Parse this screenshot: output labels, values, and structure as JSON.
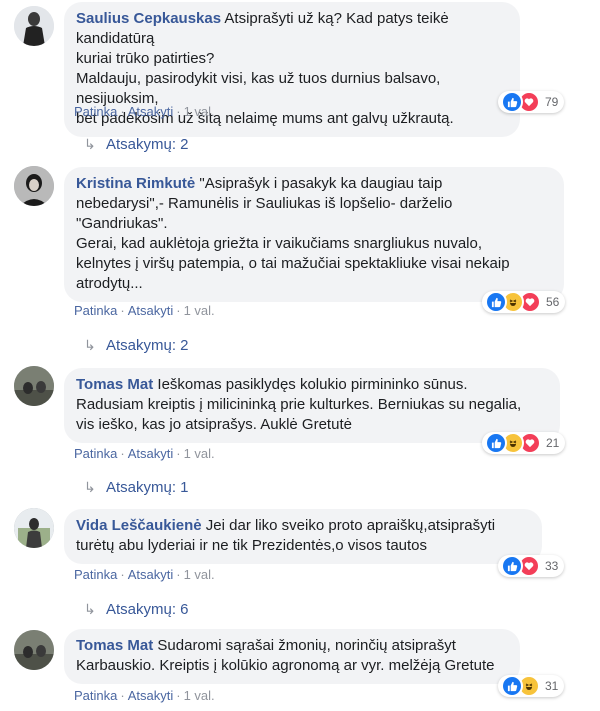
{
  "actions": {
    "like": "Patinka",
    "reply": "Atsakyti",
    "separator": "·"
  },
  "comments": [
    {
      "author": "Saulius Cepkauskas",
      "lines": [
        "Atsiprašyti už ką? Kad patys teikė kandidatūrą",
        "kuriai trūko patirties?",
        "Maldauju, pasirodykit visi, kas už tuos durnius balsavo, nesijuoksim,",
        "bet padėkosim už šitą nelaimę mums ant galvų užkrautą."
      ],
      "time": "1 val.",
      "reaction_count": "79",
      "reactions": [
        "like-icon",
        "love-icon"
      ],
      "replies": "Atsakymų: 2"
    },
    {
      "author": "Kristina Rimkutė",
      "lines": [
        "\"Asiprašyk i pasakyk ka daugiau taip",
        "nebedarysi\",- Ramunėlis ir Sauliukas iš lopšelio- darželio",
        "\"Gandriukas\".",
        "Gerai, kad auklėtoja griežta ir vaikučiams snargliukus nuvalo,",
        "kelnytes į viršų patempia, o tai mažučiai spektakliuke visai nekaip",
        "atrodytų..."
      ],
      "time": "1 val.",
      "reaction_count": "56",
      "reactions": [
        "like-icon",
        "haha-icon",
        "love-icon"
      ],
      "replies": "Atsakymų: 2"
    },
    {
      "author": "Tomas Mat",
      "lines": [
        "Ieškomas pasiklydęs kolukio pirmininko sūnus.",
        "Radusiam kreiptis į milicininką prie kulturkes. Berniukas su negalia,",
        "vis ieško, kas jo atsiprašys. Auklė Gretutė"
      ],
      "time": "1 val.",
      "reaction_count": "21",
      "reactions": [
        "like-icon",
        "haha-icon",
        "love-icon"
      ],
      "replies": "Atsakymų: 1"
    },
    {
      "author": "Vida Leščaukienė",
      "lines": [
        "Jei dar liko sveiko proto apraiškų,atsiprašyti",
        "turėtų abu lyderiai ir ne tik Prezidentės,o visos tautos"
      ],
      "time": "1 val.",
      "reaction_count": "33",
      "reactions": [
        "like-icon",
        "love-icon"
      ],
      "replies": "Atsakymų: 6"
    },
    {
      "author": "Tomas Mat",
      "lines": [
        "Sudaromi sąrašai žmonių, norinčių atsiprašyt",
        "Karbauskio. Kreiptis į kolūkio agronomą ar vyr. melžėją Gretute"
      ],
      "time": "1 val.",
      "reaction_count": "31",
      "reactions": [
        "like-icon",
        "haha-icon"
      ],
      "replies": ""
    }
  ],
  "colors": {
    "author": "#385898",
    "link": "#4b67a1",
    "bubble": "#f2f3f5",
    "like": "#1877f2",
    "love": "#f33e58",
    "haha": "#f7c33b"
  }
}
